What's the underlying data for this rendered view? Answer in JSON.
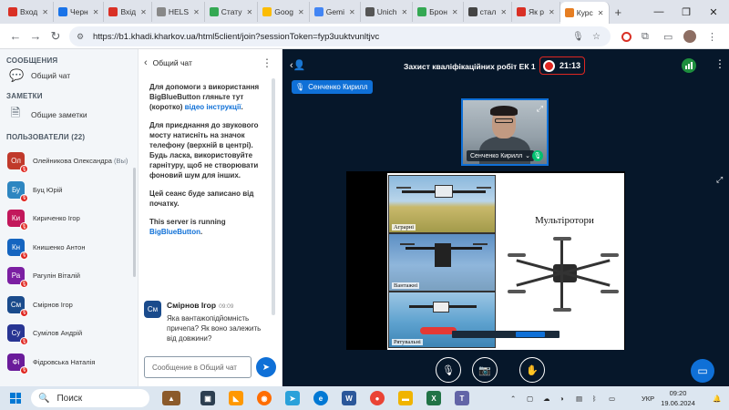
{
  "browser": {
    "tabs": [
      {
        "label": "Вход",
        "color": "#d93025"
      },
      {
        "label": "Черн",
        "color": "#1a73e8"
      },
      {
        "label": "Вхід",
        "color": "#d93025"
      },
      {
        "label": "HELS",
        "color": "#888888"
      },
      {
        "label": "Стату",
        "color": "#34a853"
      },
      {
        "label": "Goog",
        "color": "#fbbc04"
      },
      {
        "label": "Gemi",
        "color": "#4285f4"
      },
      {
        "label": "Unich",
        "color": "#555555"
      },
      {
        "label": "Брон",
        "color": "#34a853"
      },
      {
        "label": "стал",
        "color": "#444444"
      },
      {
        "label": "Як р",
        "color": "#d93025"
      },
      {
        "label": "Курс",
        "color": "#e67e22"
      }
    ],
    "url": "https://b1.khadi.kharkov.ua/html5client/join?sessionToken=fyp3uuktvunltjvc"
  },
  "sidebar": {
    "messages_title": "СООБЩЕНИЯ",
    "public_chat": "Общий чат",
    "notes_title": "ЗАМЕТКИ",
    "shared_notes": "Общие заметки",
    "users_title": "ПОЛЬЗОВАТЕЛИ (22)",
    "users": [
      {
        "initials": "Ол",
        "name": "Олейникова Олександра",
        "you": " (Вы)",
        "color": "#c0392b"
      },
      {
        "initials": "Бу",
        "name": "Буц Юрій",
        "you": "",
        "color": "#2e86c1"
      },
      {
        "initials": "Ки",
        "name": "Кириченко Ігор",
        "you": "",
        "color": "#c2185b"
      },
      {
        "initials": "Кн",
        "name": "Книшенко Антон",
        "you": "",
        "color": "#1565c0"
      },
      {
        "initials": "Ра",
        "name": "Рагулін Віталій",
        "you": "",
        "color": "#7b1fa2"
      },
      {
        "initials": "См",
        "name": "Смірнов Ігор",
        "you": "",
        "color": "#1a4b8c"
      },
      {
        "initials": "Су",
        "name": "Сумілов Андрій",
        "you": "",
        "color": "#283593"
      },
      {
        "initials": "Фі",
        "name": "Фідровська Наталія",
        "you": "",
        "color": "#6a1b9a"
      }
    ]
  },
  "chat": {
    "title": "Общий чат",
    "welcome_1": "Для допомоги з використання BigBlueButton гляньте тут (коротко) ",
    "welcome_1_link": "відео інструкції",
    "welcome_2": "Для приєднання до звукового мосту натисніть на значок телефону (верхній в центрі). Будь ласка, використовуйте гарнітуру, щоб не створювати фоновий шум для інших.",
    "welcome_3": "Цей сеанс буде записано від початку.",
    "welcome_4": "This server is running ",
    "welcome_4_link": "BigBlueButton",
    "msg_initials": "См",
    "msg_name": "Смірнов Ігор",
    "msg_time": "09:09",
    "msg_text": "Яка вантажопідйомність причепа? Як воно залежить від довжини?",
    "input_placeholder": "Сообщение в Общий чат"
  },
  "meeting": {
    "title": "Захист кваліфікаційних робіт ЕК 1",
    "timer": "21:13",
    "talker": "Сенченко Кирилл",
    "cam_name": "Сенченко Кирилл"
  },
  "slide": {
    "title": "Мультіротори",
    "labels": [
      "Аграрні",
      "Вантажні",
      "Рятувальні"
    ]
  },
  "taskbar": {
    "search": "Поиск",
    "lang": "УКР",
    "time": "09:20",
    "date": "19.06.2024"
  }
}
